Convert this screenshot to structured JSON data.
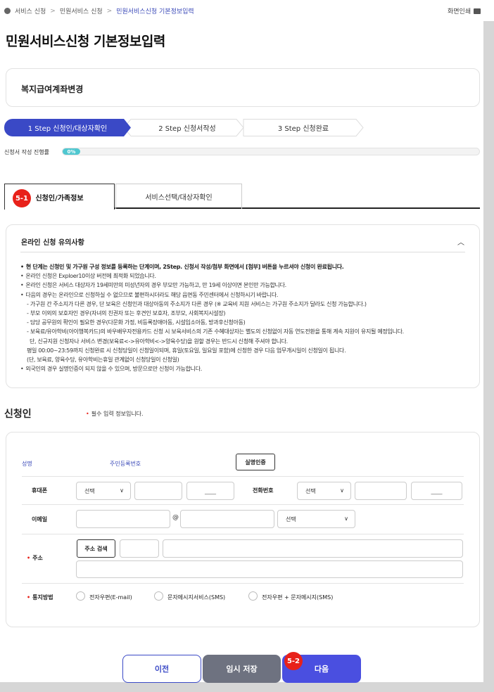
{
  "breadcrumb": {
    "items": [
      "서비스 신청",
      "민원서비스 신청",
      "민원서비스신청 기본정보입력"
    ],
    "separator": ">"
  },
  "print_label": "화면인쇄",
  "page_title": "민원서비스신청 기본정보입력",
  "service_name": "복지급여계좌변경",
  "steps": [
    {
      "label": "1 Step 신청인/대상자확인",
      "active": true
    },
    {
      "label": "2 Step 신청서작성",
      "active": false
    },
    {
      "label": "3 Step 신청완료",
      "active": false
    }
  ],
  "progress": {
    "label": "신청서 작성 진행률",
    "value_text": "0%",
    "value": 0
  },
  "tabs": [
    {
      "label": "신청인/가족정보",
      "active": true
    },
    {
      "label": "서비스선택/대상자확인",
      "active": false
    }
  ],
  "annotations": {
    "tab_badge": "5-1",
    "next_badge": "5-2"
  },
  "notice": {
    "title": "온라인 신청 유의사항",
    "lines": [
      "현 단계는 신청인 및 가구원 구성 정보를 등록하는 단계이며, 2Step. 신청서 작성/첨부 화면에서 [첨부] 버튼을 누르셔야 신청이 완료됩니다.",
      "온라인 신청은 Exploer10이상 버전에 최적화 되었습니다.",
      "온라인 신청은 서비스 대상자가 19세미만의 미성년자의 경우 부모만 가능하고, 만 19세 이상이면 본인만 가능합니다.",
      "다음의 경우는 온라인으로 신청하실 수 없으므로 불편하시더라도 해당 읍면동 주민센터에서 신청하시기 바랍니다.",
      "- 가구원 간 주소지가 다른 경우, 단 보육은 신청인과 대상아동의 주소지가 다른 경우 (※ 교육비 지원 서비스는 가구원 주소지가 달라도 신청 가능합니다.)",
      "- 부모 이외의 보호자인 경우(자녀의 친권자 또는 후견인 보호자, 조부모, 사회복지시설장)",
      "- 담당 공무원의 확인이 필요한 경우(다문화 가정, 비등록장애아동, 시설입소아동, 방과후신청아동)",
      "- 보육료/유아학비(아이행복카드)의 바우배우자전용카드 신청 시 보육서비스의 기존 수혜대상자는 별도의 신청없이 자동 연도전환을 통해 계속 지원이 유지될 예정입니다.",
      "단, 신규지원 신청자나 서비스 변경(보육료<->유아학비<->양육수당)을 원할 경우는 반드시 신청해 주셔야 합니다.",
      "평일 00:00~23:59까지 신청완료 시 신청당일이 신청일이되며, 휴일(토요일, 일요일 포함)에 신청한 경우 다음 업무개시일이 신청일이 됩니다.",
      "(단, 보육료, 양육수당, 유아학비는휴일 관계없이 신청당일이 신청일)",
      "외국인의 경우 실명인증이 되지 않을 수 있으며, 방문으로만 신청이 가능합니다."
    ]
  },
  "applicant": {
    "section_title": "신청인",
    "required_note": "필수 입력 정보입니다.",
    "name_label": "성명",
    "rrn_label": "주민등록번호",
    "verify_button": "실명인증",
    "mobile_label": "휴대폰",
    "mobile_select": "선택",
    "mobile_suffix": "____",
    "phone_label": "전화번호",
    "phone_select": "선택",
    "phone_suffix": "____",
    "email_label": "이메일",
    "email_at": "@",
    "email_select": "선택",
    "address_label": "주소",
    "address_search_button": "주소 검색",
    "notify_label": "통지방법",
    "notify_options": [
      "전자우편(E-mail)",
      "문자메시지서비스(SMS)",
      "전자우편 + 문자메시지(SMS)"
    ]
  },
  "buttons": {
    "prev": "이전",
    "save": "임시 저장",
    "next": "다음"
  },
  "colors": {
    "accent": "#3a49c6",
    "badge": "#e8211a",
    "progress": "#4fc7d0",
    "save_button": "#6e7280",
    "next_button": "#4a4fe0"
  }
}
